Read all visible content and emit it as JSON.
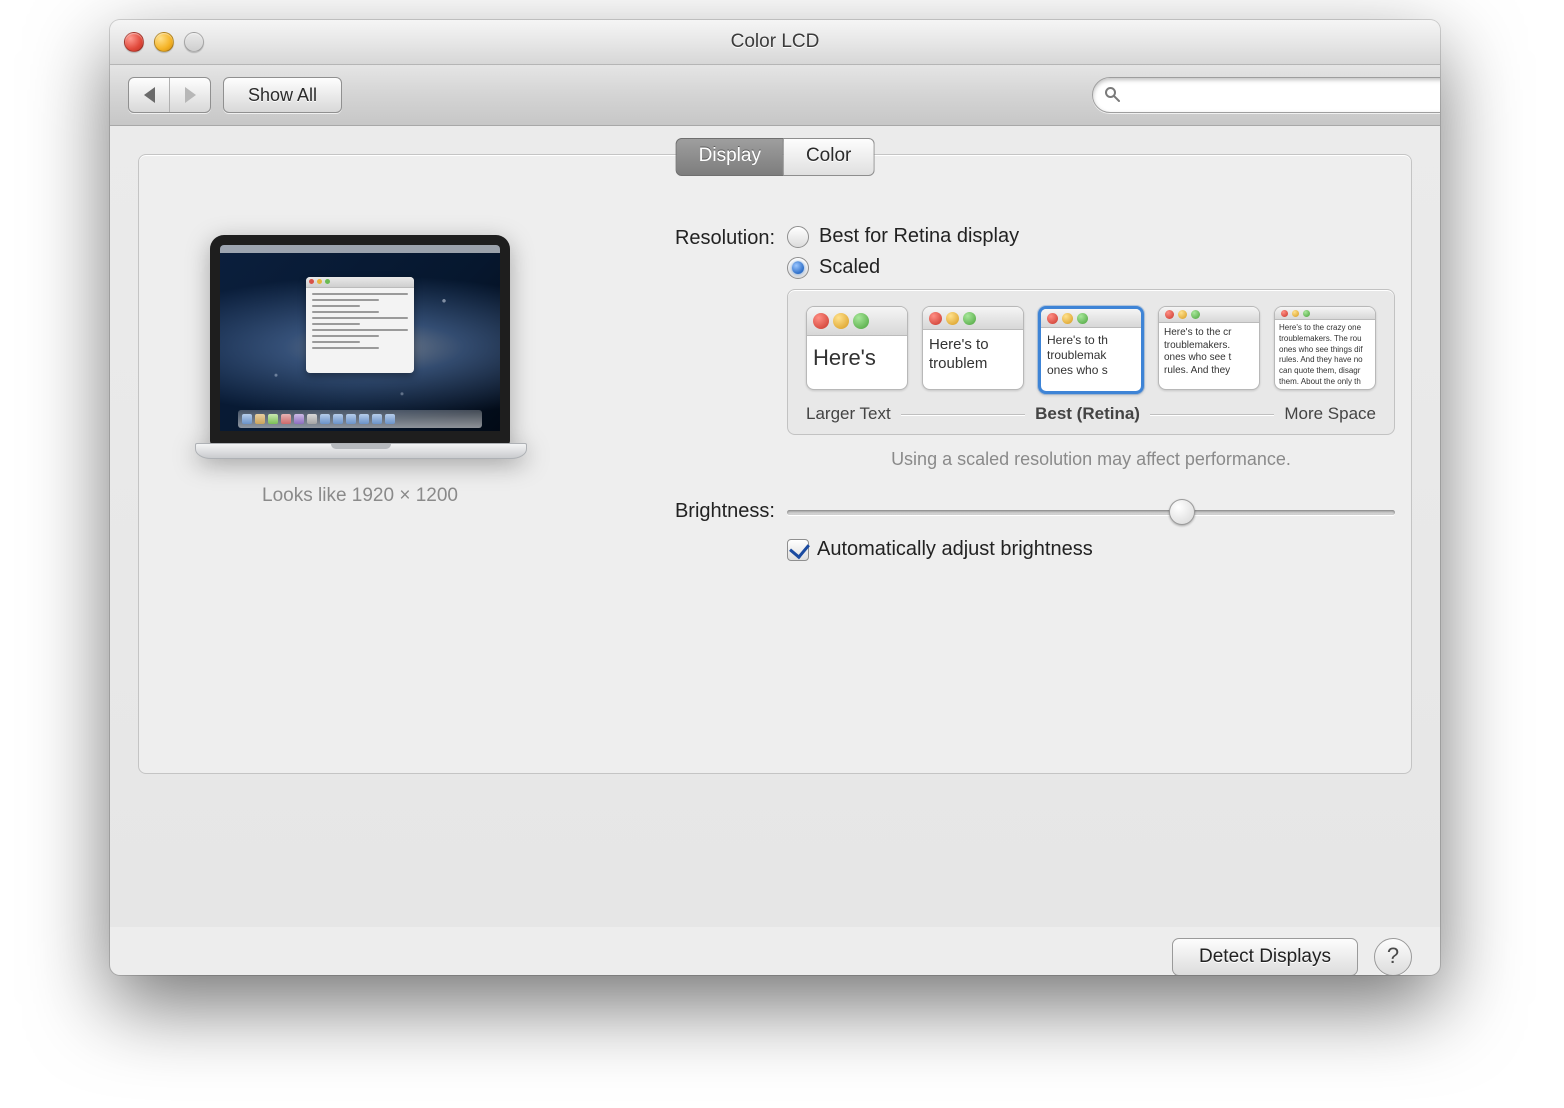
{
  "window": {
    "title": "Color LCD"
  },
  "toolbar": {
    "show_all_label": "Show All",
    "search_placeholder": ""
  },
  "tabs": {
    "display": "Display",
    "color": "Color",
    "active": "display"
  },
  "preview": {
    "caption": "Looks like 1920 × 1200"
  },
  "resolution": {
    "label": "Resolution:",
    "options": {
      "best": "Best for Retina display",
      "scaled": "Scaled"
    },
    "selected": "scaled",
    "scale_labels": {
      "left": "Larger Text",
      "mid": "Best (Retina)",
      "right": "More Space"
    },
    "selected_thumb_index": 2,
    "thumbs": [
      "Here's",
      "Here's to troublem",
      "Here's to th troublemak ones who s",
      "Here's to the cr troublemakers. ones who see t rules. And they",
      "Here's to the crazy one troublemakers. The rou ones who see things dif rules. And they have no can quote them, disagr them. About the only th Because they change th"
    ],
    "note": "Using a scaled resolution may affect performance."
  },
  "brightness": {
    "label": "Brightness:",
    "value_percent": 65,
    "auto_checkbox": {
      "checked": true,
      "label": "Automatically adjust brightness"
    }
  },
  "footer": {
    "detect": "Detect Displays",
    "help_symbol": "?"
  }
}
